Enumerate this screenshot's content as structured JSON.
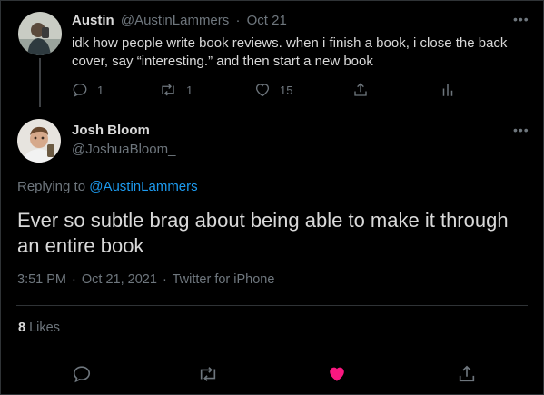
{
  "parent_tweet": {
    "display_name": "Austin",
    "handle": "@AustinLammers",
    "separator": "·",
    "date": "Oct 21",
    "text": "idk how people write book reviews. when i finish a book, i close the back cover, say “interesting.” and then start a new book",
    "reply_count": "1",
    "retweet_count": "1",
    "like_count": "15",
    "more_icon": "more-horizontal-icon"
  },
  "main_tweet": {
    "display_name": "Josh Bloom",
    "handle": "@JoshuaBloom_",
    "replying_prefix": "Replying to",
    "replying_to": "@AustinLammers",
    "text": "Ever so subtle brag about being able to make it through an entire book",
    "time": "3:51 PM",
    "date": "Oct 21, 2021",
    "source": "Twitter for iPhone",
    "separator": "·",
    "like_count": "8",
    "likes_label": "Likes",
    "liked": true
  },
  "colors": {
    "background": "#000000",
    "text": "#d9d9d9",
    "muted": "#6e767d",
    "link": "#1d9bf0",
    "like_active": "#f91880",
    "divider": "#2f3336"
  }
}
